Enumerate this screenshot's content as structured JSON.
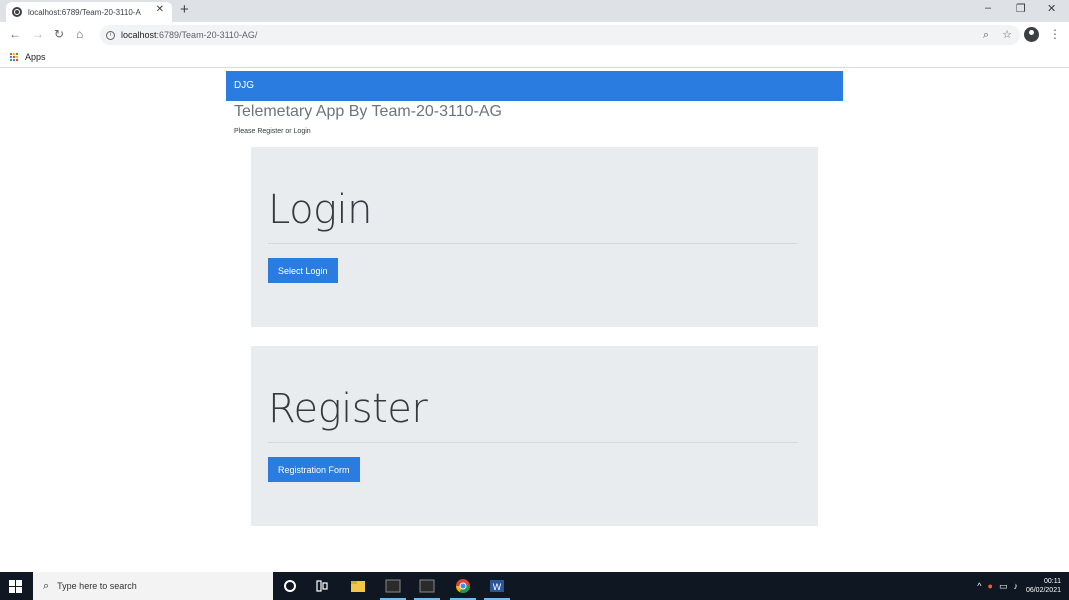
{
  "browser": {
    "tab_title": "localhost:6789/Team-20-3110-A",
    "url_host": "localhost",
    "url_path": ":6789/Team-20-3110-AG/",
    "new_tab_label": "+",
    "bookmarks": {
      "apps_label": "Apps"
    }
  },
  "page": {
    "brand": "DJG",
    "title": "Telemetary App By Team-20-3110-AG",
    "subtitle": "Please Register or Login",
    "login": {
      "heading": "Login",
      "button_label": "Select Login"
    },
    "register": {
      "heading": "Register",
      "button_label": "Registration Form"
    },
    "accent_color": "#2a7ce0",
    "panel_color": "#e9ecef"
  },
  "taskbar": {
    "search_placeholder": "Type here to search",
    "time": "00:11",
    "date": "06/02/2021"
  }
}
